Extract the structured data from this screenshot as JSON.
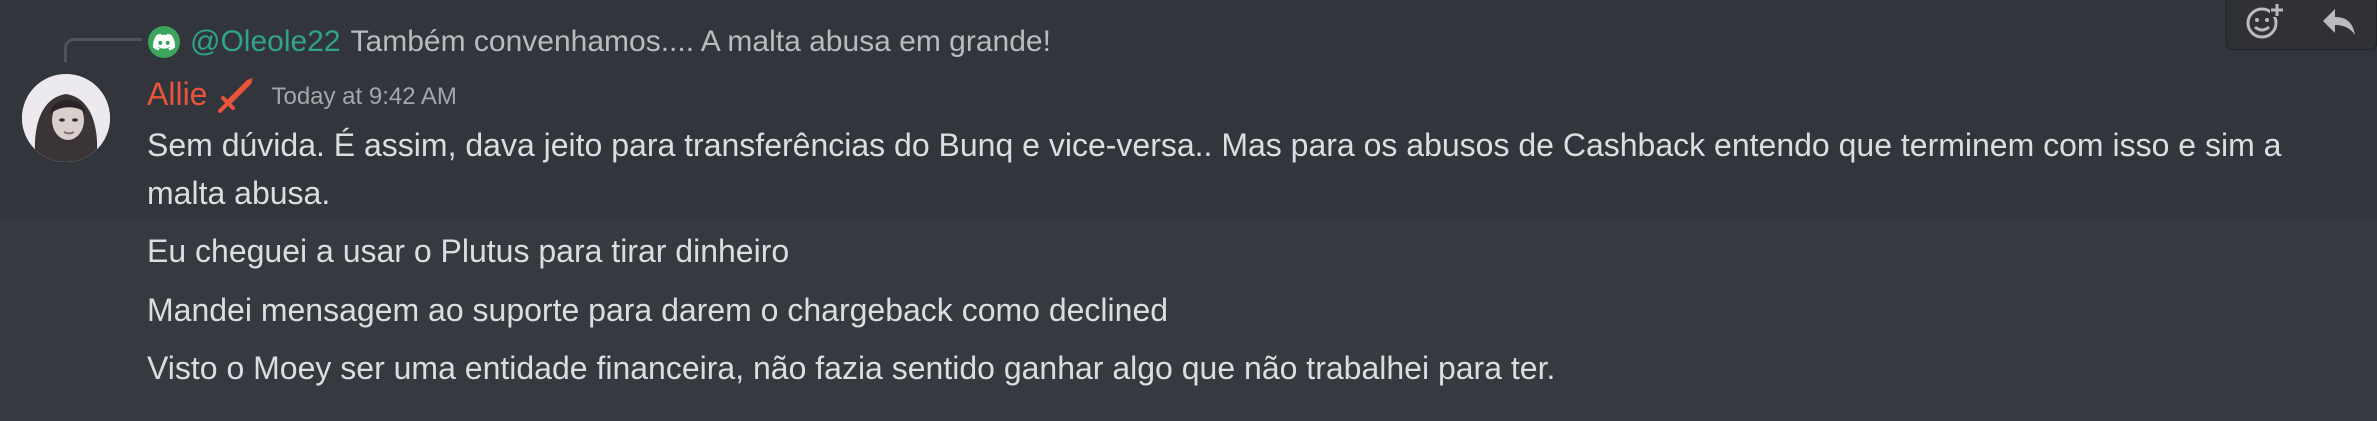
{
  "reply": {
    "author": "@Oleole22",
    "text": "Também convenhamos.... A malta abusa em grande!",
    "avatar_icon": "discord-logo-icon"
  },
  "message": {
    "author": "Allie",
    "author_color": "#e8543b",
    "role_icon": "sword-icon",
    "timestamp": "Today at 9:42 AM",
    "lines": [
      "Sem dúvida. É assim, dava jeito para transferências do Bunq e vice-versa.. Mas para os abusos de Cashback entendo que terminem com isso e sim a",
      "malta abusa.",
      "Eu cheguei a usar o Plutus para tirar dinheiro",
      "Mandei mensagem ao suporte para darem o chargeback como declined",
      "Visto o Moey ser uma entidade financeira, não fazia sentido ganhar algo que não trabalhei para ter."
    ]
  },
  "actions": {
    "icons": [
      "add-reaction-icon",
      "reply-icon"
    ]
  }
}
